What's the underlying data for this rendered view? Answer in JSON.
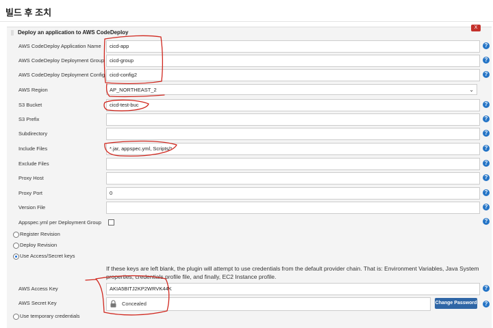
{
  "page": {
    "title": "빌드 후 조치"
  },
  "section": {
    "title": "Deploy an application to AWS CodeDeploy",
    "close_label": "X"
  },
  "fields": {
    "application_name": {
      "label": "AWS CodeDeploy Application Name",
      "value": "cicd-app"
    },
    "deployment_group": {
      "label": "AWS CodeDeploy Deployment Group",
      "value": "cicd-group"
    },
    "deployment_config": {
      "label": "AWS CodeDeploy Deployment Config",
      "value": "cicd-config2"
    },
    "region": {
      "label": "AWS Region",
      "value": "AP_NORTHEAST_2"
    },
    "s3_bucket": {
      "label": "S3 Bucket",
      "value": "cicd-test-buc"
    },
    "s3_prefix": {
      "label": "S3 Prefix",
      "value": ""
    },
    "subdirectory": {
      "label": "Subdirectory",
      "value": ""
    },
    "include_files": {
      "label": "Include Files",
      "value": "*.jar, appspec.yml, Scripts/*"
    },
    "exclude_files": {
      "label": "Exclude Files",
      "value": ""
    },
    "proxy_host": {
      "label": "Proxy Host",
      "value": ""
    },
    "proxy_port": {
      "label": "Proxy Port",
      "value": "0"
    },
    "version_file": {
      "label": "Version File",
      "value": ""
    },
    "appspec_per_group": {
      "label": "Appspec.yml per Deployment Group",
      "checked": false
    }
  },
  "radios": {
    "register_revision": {
      "label": "Register Revision",
      "selected": false
    },
    "deploy_revision": {
      "label": "Deploy Revision",
      "selected": false
    },
    "access_keys": {
      "label": "Use Access/Secret keys",
      "selected": true
    },
    "temporary_credentials": {
      "label": "Use temporary credentials",
      "selected": false
    }
  },
  "credentials": {
    "info_text": "If these keys are left blank, the plugin will attempt to use credentials from the default provider chain. That is: Environment Variables, Java System properties, credentials profile file, and finally, EC2 Instance profile.",
    "access_key": {
      "label": "AWS Access Key",
      "value": "AKIA5BITJ2KP2WRVK44K"
    },
    "secret_key": {
      "label": "AWS Secret Key",
      "value": "Concealed"
    },
    "change_password_label": "Change Password"
  },
  "help_icon_glyph": "?",
  "colors": {
    "help_icon": "#2474c6",
    "close_button": "#c4312b",
    "change_button": "#2f66a6",
    "annotation": "#d0261d"
  }
}
